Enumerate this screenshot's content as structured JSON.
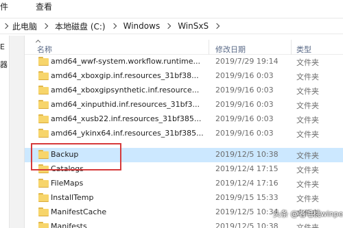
{
  "top_strip": {
    "left_text": "件",
    "right_text": "查看"
  },
  "breadcrumb": [
    "此电脑",
    "本地磁盘 (C:)",
    "Windows",
    "WinSxS"
  ],
  "left_pane": {
    "lines": [
      "E",
      "器"
    ]
  },
  "columns": {
    "name": "名称",
    "date": "修改日期",
    "type": "类型"
  },
  "rows": [
    {
      "name": "amd64_wwf-system.workflow.runtime...",
      "date": "2019/7/29 19:14",
      "type": "文件夹"
    },
    {
      "name": "amd64_xboxgip.inf.resources_31bf38...",
      "date": "2019/9/16 0:03",
      "type": "文件夹"
    },
    {
      "name": "amd64_xboxgipsynthetic.inf.resource...",
      "date": "2019/9/16 0:03",
      "type": "文件夹"
    },
    {
      "name": "amd64_xinputhid.inf.resources_31bf3...",
      "date": "2019/9/16 0:03",
      "type": "文件夹"
    },
    {
      "name": "amd64_xusb22.inf.resources_31bf385...",
      "date": "2019/9/16 0:03",
      "type": "文件夹"
    },
    {
      "name": "amd64_ykinx64.inf.resources_31bf385...",
      "date": "2019/9/16 0:03",
      "type": "文件夹"
    },
    {
      "name": "Backup",
      "date": "2019/12/5 10:38",
      "type": "文件夹"
    },
    {
      "name": "Catalogs",
      "date": "2019/12/4 17:15",
      "type": "文件夹"
    },
    {
      "name": "FileMaps",
      "date": "2019/12/4 17:16",
      "type": "文件夹"
    },
    {
      "name": "InstallTemp",
      "date": "2019/9/15 15:33",
      "type": "文件夹"
    },
    {
      "name": "ManifestCache",
      "date": "2019/12/5 10:34",
      "type": "文件夹"
    },
    {
      "name": "Manifests",
      "date": "2019/12/5 10:38",
      "type": "文件夹"
    }
  ],
  "watermark": "头条 @老毛桃winpe",
  "colors": {
    "selection": "#cce8ff",
    "highlight_box": "#d6393a",
    "folder": "#f7d56b"
  }
}
